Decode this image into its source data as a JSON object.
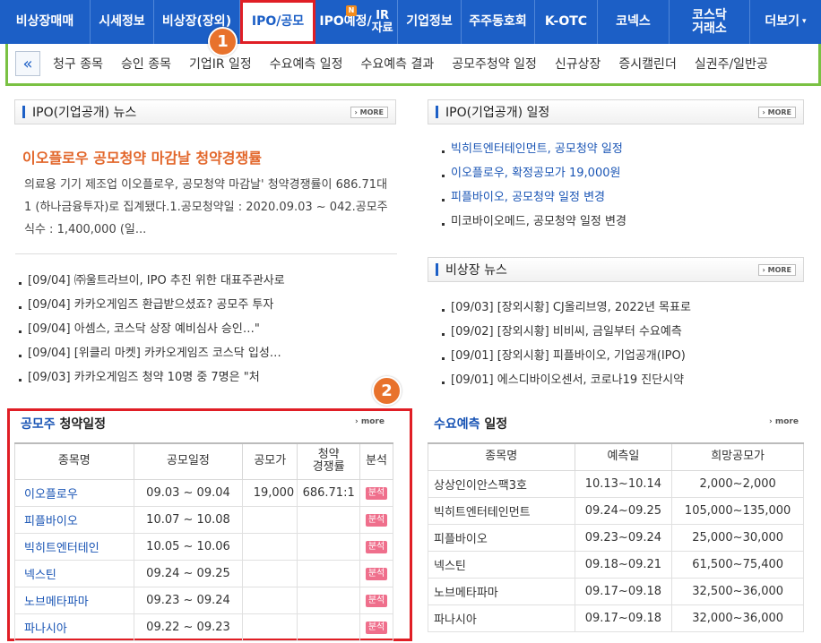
{
  "topnav": [
    {
      "label": "비상장매매"
    },
    {
      "label": "시세정보"
    },
    {
      "label": "비상장(장외)"
    },
    {
      "label": "IPO/공모",
      "active": true
    },
    {
      "label1": "IPO예정/",
      "label2": "IR",
      "label3": "자료",
      "badge": "N"
    },
    {
      "label": "기업정보"
    },
    {
      "label": "주주동호회"
    },
    {
      "label": "K-OTC"
    },
    {
      "label": "코넥스"
    },
    {
      "label1": "코스닥",
      "label2": "거래소"
    },
    {
      "label": "더보기",
      "caret": "▾"
    }
  ],
  "subnav": {
    "back": "«",
    "items": [
      "청구 종목",
      "승인 종목",
      "기업IR 일정",
      "수요예측 일정",
      "수요예측 결과",
      "공모주청약 일정",
      "신규상장",
      "증시캘린더",
      "실권주/일반공"
    ]
  },
  "markers": [
    "1",
    "2"
  ],
  "ipo_news": {
    "title": "IPO(기업공개) 뉴스",
    "more": "› MORE",
    "headline": "이오플로우 공모청약 마감날 청약경쟁률",
    "summary": "의료용 기기 제조업 이오플로우, 공모청약 마감날' 청약경쟁률이 686.71대1 (하나금융투자)로 집계됐다.1.공모청약일 : 2020.09.03 ~ 042.공모주식수 : 1,400,000 (일...",
    "items": [
      "[09/04] ㈜울트라브이, IPO 추진 위한 대표주관사로",
      "[09/04] 카카오게임즈 환급받으셨죠? 공모주 투자",
      "[09/04] 아셈스, 코스닥 상장 예비심사 승인…\"",
      "[09/04] [위클리 마켓] 카카오게임즈 코스닥 입성…",
      "[09/03] 카카오게임즈 청약 10명 중 7명은 \"처"
    ]
  },
  "ipo_schedule": {
    "title": "IPO(기업공개) 일정",
    "more": "› MORE",
    "items": [
      "빅히트엔터테인먼트, 공모청약 일정",
      "이오플로우, 확정공모가 19,000원",
      "피플바이오, 공모청약 일정 변경",
      "미코바이오메드, 공모청약 일정 변경"
    ]
  },
  "unlisted_news": {
    "title": "비상장 뉴스",
    "more": "› MORE",
    "items": [
      "[09/03] [장외시황] CJ올리브영, 2022년 목표로",
      "[09/02] [장외시황] 비비씨, 금일부터 수요예측",
      "[09/01] [장외시황] 피플바이오, 기업공개(IPO)",
      "[09/01] 에스디바이오센서, 코로나19 진단시약"
    ]
  },
  "subscription": {
    "title_a": "공모주",
    "title_b": " 청약일정",
    "more": "› more",
    "headers": [
      "종목명",
      "공모일정",
      "공모가",
      "청약",
      "경쟁률",
      "분석"
    ],
    "badge": "분석",
    "rows": [
      {
        "name": "이오플로우",
        "period": "09.03 ~ 09.04",
        "price": "19,000",
        "rate": "686.71:1"
      },
      {
        "name": "피플바이오",
        "period": "10.07 ~ 10.08",
        "price": "",
        "rate": ""
      },
      {
        "name": "빅히트엔터테인",
        "period": "10.05 ~ 10.06",
        "price": "",
        "rate": ""
      },
      {
        "name": "넥스틴",
        "period": "09.24 ~ 09.25",
        "price": "",
        "rate": ""
      },
      {
        "name": "노브메타파마",
        "period": "09.23 ~ 09.24",
        "price": "",
        "rate": ""
      },
      {
        "name": "파나시아",
        "period": "09.22 ~ 09.23",
        "price": "",
        "rate": ""
      }
    ]
  },
  "demand": {
    "title_a": "수요예측",
    "title_b": " 일정",
    "more": "› more",
    "headers": [
      "종목명",
      "예측일",
      "희망공모가"
    ],
    "rows": [
      {
        "name": "상상인이안스팩3호",
        "date": "10.13~10.14",
        "price": "2,000~2,000"
      },
      {
        "name": "빅히트엔터테인먼트",
        "date": "09.24~09.25",
        "price": "105,000~135,000"
      },
      {
        "name": "피플바이오",
        "date": "09.23~09.24",
        "price": "25,000~30,000"
      },
      {
        "name": "넥스틴",
        "date": "09.18~09.21",
        "price": "61,500~75,400"
      },
      {
        "name": "노브메타파마",
        "date": "09.17~09.18",
        "price": "32,500~36,000"
      },
      {
        "name": "파나시아",
        "date": "09.17~09.18",
        "price": "32,000~36,000"
      }
    ]
  }
}
